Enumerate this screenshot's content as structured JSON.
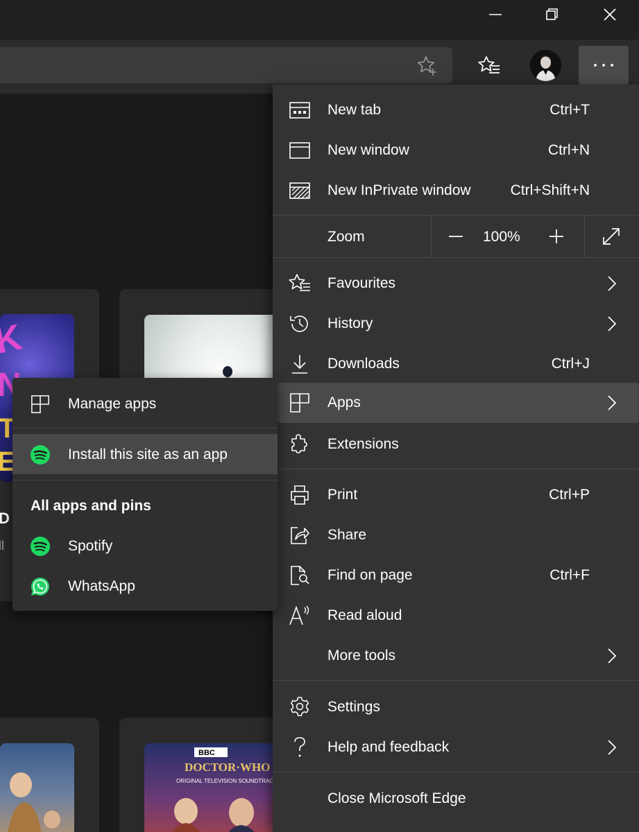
{
  "window": {
    "minimize_icon": "minimize-icon",
    "restore_icon": "restore-icon",
    "close_icon": "close-icon"
  },
  "toolbar": {
    "add_favourite_icon": "star-plus-icon",
    "favourites_icon": "favourites-list-icon",
    "profile_icon": "avatar",
    "more_label": "···"
  },
  "menu": {
    "items_top": [
      {
        "label": "New tab",
        "shortcut": "Ctrl+T",
        "icon": "new-tab-icon"
      },
      {
        "label": "New window",
        "shortcut": "Ctrl+N",
        "icon": "new-window-icon"
      },
      {
        "label": "New InPrivate window",
        "shortcut": "Ctrl+Shift+N",
        "icon": "inprivate-icon"
      }
    ],
    "zoom": {
      "label": "Zoom",
      "value": "100%",
      "decrease": "−",
      "increase": "+"
    },
    "items_mid": [
      {
        "label": "Favourites",
        "shortcut": "",
        "icon": "favourites-icon",
        "submenu": true
      },
      {
        "label": "History",
        "shortcut": "",
        "icon": "history-icon",
        "submenu": true
      },
      {
        "label": "Downloads",
        "shortcut": "Ctrl+J",
        "icon": "download-icon"
      },
      {
        "label": "Apps",
        "shortcut": "",
        "icon": "apps-icon",
        "submenu": true,
        "highlighted": true
      },
      {
        "label": "Extensions",
        "shortcut": "",
        "icon": "puzzle-icon"
      }
    ],
    "items_tools": [
      {
        "label": "Print",
        "shortcut": "Ctrl+P",
        "icon": "print-icon"
      },
      {
        "label": "Share",
        "shortcut": "",
        "icon": "share-icon"
      },
      {
        "label": "Find on page",
        "shortcut": "Ctrl+F",
        "icon": "find-icon"
      },
      {
        "label": "Read aloud",
        "shortcut": "",
        "icon": "read-aloud-icon"
      },
      {
        "label": "More tools",
        "shortcut": "",
        "icon": "",
        "submenu": true
      }
    ],
    "items_bottom": [
      {
        "label": "Settings",
        "icon": "gear-icon"
      },
      {
        "label": "Help and feedback",
        "icon": "help-icon",
        "submenu": true
      }
    ],
    "close": {
      "label": "Close Microsoft Edge"
    }
  },
  "apps_submenu": {
    "manage": {
      "label": "Manage apps",
      "icon": "apps-icon"
    },
    "install": {
      "label": "Install this site as an app",
      "icon": "spotify-icon"
    },
    "section_heading": "All apps and pins",
    "apps": [
      {
        "label": "Spotify",
        "icon": "spotify-icon"
      },
      {
        "label": "WhatsApp",
        "icon": "whatsapp-icon"
      }
    ]
  },
  "background_page": {
    "partial_title": "D",
    "partial_subtitle": "ll"
  },
  "colors": {
    "menu_bg": "#333333",
    "highlight": "#4a4a4a",
    "spotify_green": "#1ed760",
    "whatsapp_green": "#25d366"
  }
}
